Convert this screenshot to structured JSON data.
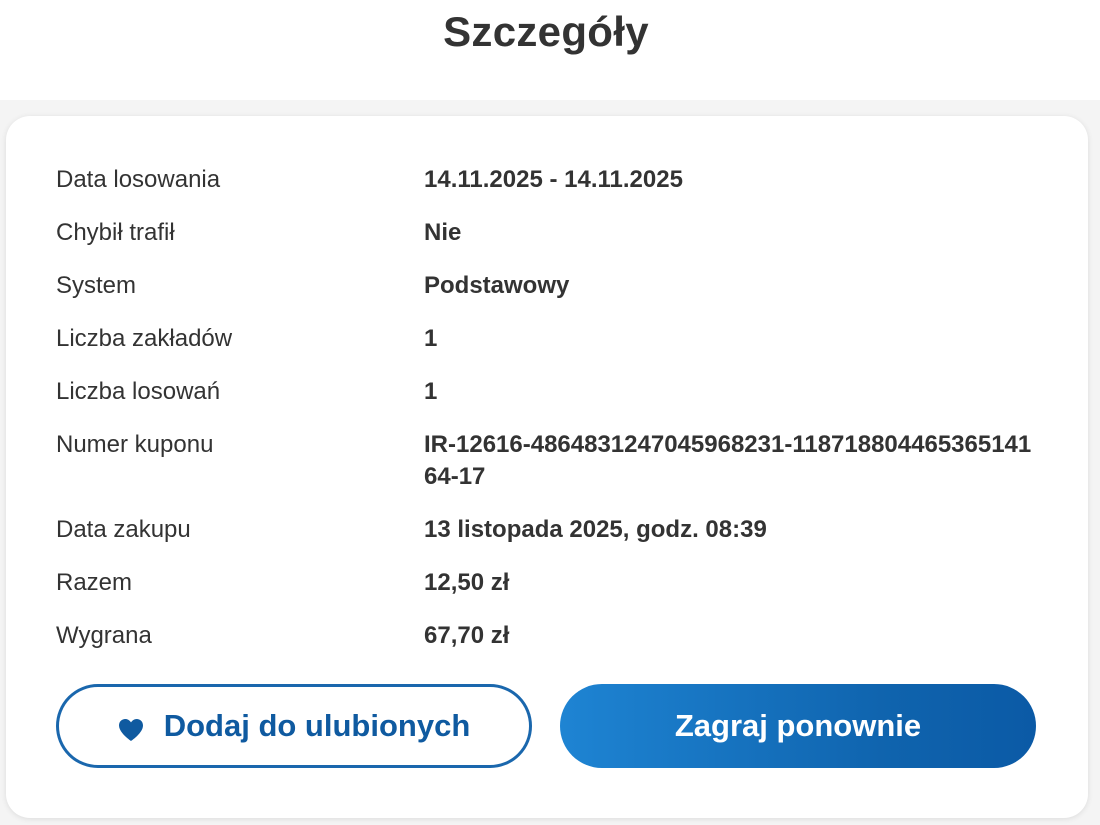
{
  "page": {
    "title": "Szczegóły"
  },
  "details": [
    {
      "label": "Data losowania",
      "value": "14.11.2025 - 14.11.2025"
    },
    {
      "label": "Chybił trafił",
      "value": "Nie"
    },
    {
      "label": "System",
      "value": "Podstawowy"
    },
    {
      "label": "Liczba zakładów",
      "value": "1"
    },
    {
      "label": "Liczba losowań",
      "value": "1"
    },
    {
      "label": "Numer kuponu",
      "value": "IR-12616-4864831247045968231-11871880446536514164-17"
    },
    {
      "label": "Data zakupu",
      "value": "13 listopada 2025, godz. 08:39"
    },
    {
      "label": "Razem",
      "value": "12,50 zł"
    },
    {
      "label": "Wygrana",
      "value": "67,70 zł"
    }
  ],
  "actions": {
    "favorite_label": "Dodaj do ulubionych",
    "favorite_icon": "heart-icon",
    "play_again_label": "Zagraj ponownie"
  },
  "colors": {
    "accent": "#0f5aa0",
    "button_gradient_start": "#1e84d3",
    "button_gradient_end": "#0b5aa6",
    "text": "#333333"
  }
}
